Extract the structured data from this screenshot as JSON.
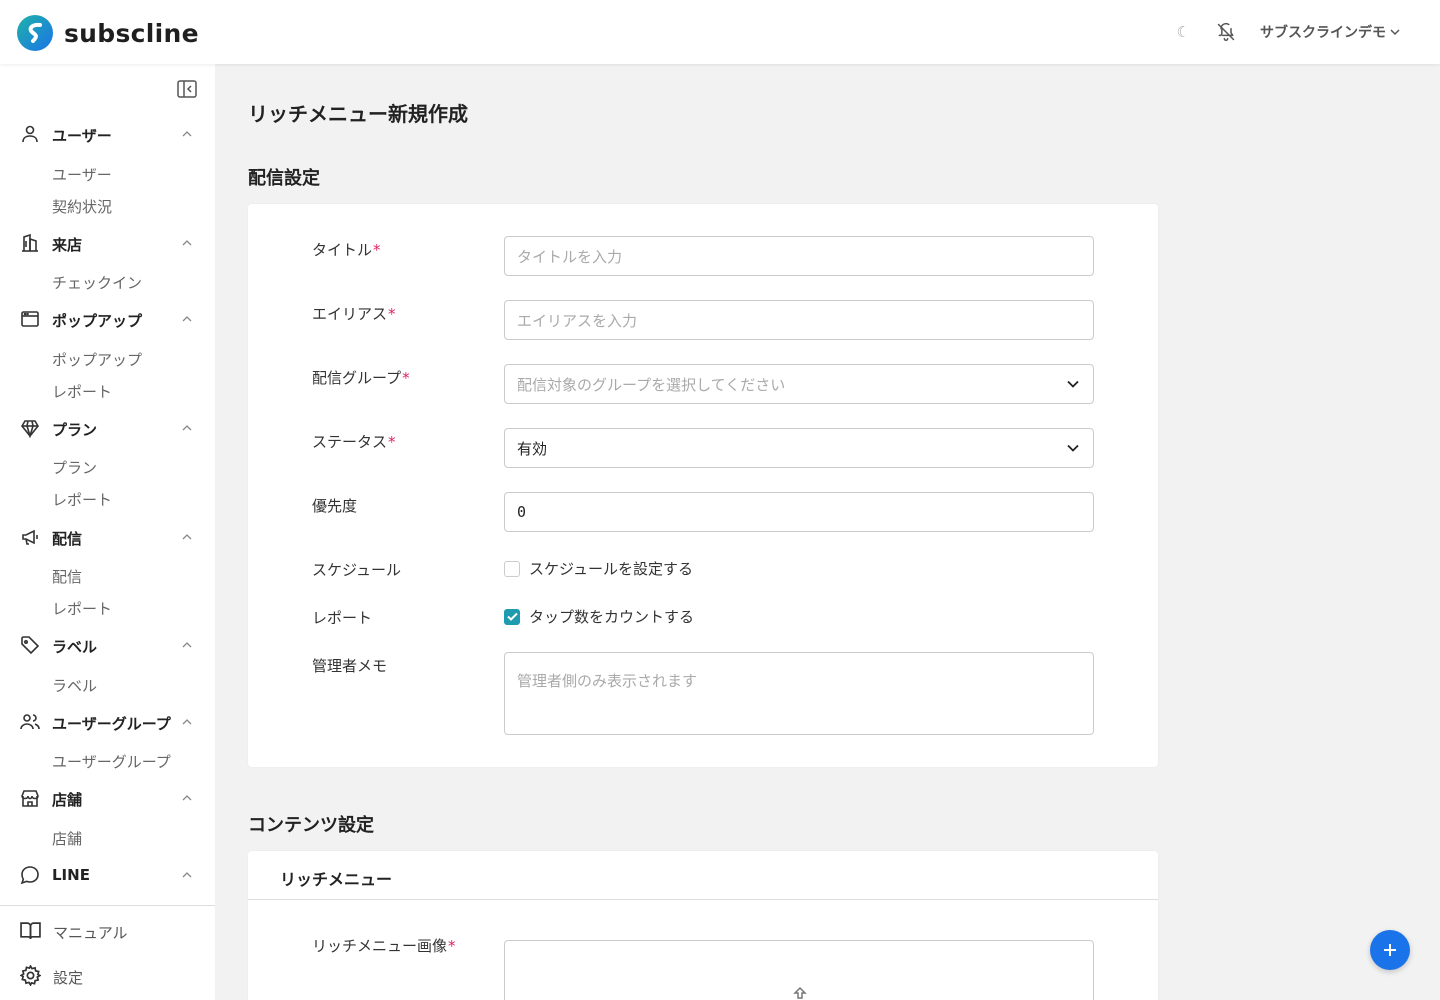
{
  "header": {
    "app_name": "subscline",
    "account_name": "サブスクラインデモ",
    "colors": {
      "logo_primary": "#1fb3a8",
      "logo_secondary": "#1a73e8"
    }
  },
  "sidebar": {
    "groups": [
      {
        "label": "ユーザー",
        "icon": "user-icon",
        "items": [
          "ユーザー",
          "契約状況"
        ]
      },
      {
        "label": "来店",
        "icon": "building-icon",
        "items": [
          "チェックイン"
        ]
      },
      {
        "label": "ポップアップ",
        "icon": "window-icon",
        "items": [
          "ポップアップ",
          "レポート"
        ]
      },
      {
        "label": "プラン",
        "icon": "diamond-icon",
        "items": [
          "プラン",
          "レポート"
        ]
      },
      {
        "label": "配信",
        "icon": "megaphone-icon",
        "items": [
          "配信",
          "レポート"
        ]
      },
      {
        "label": "ラベル",
        "icon": "tag-icon",
        "items": [
          "ラベル"
        ]
      },
      {
        "label": "ユーザーグループ",
        "icon": "users-icon",
        "items": [
          "ユーザーグループ"
        ]
      },
      {
        "label": "店舗",
        "icon": "store-icon",
        "items": [
          "店舗"
        ]
      },
      {
        "label": "LINE",
        "icon": "chat-bubble-icon",
        "items": []
      }
    ],
    "footer": [
      {
        "label": "マニュアル",
        "icon": "book-icon"
      },
      {
        "label": "設定",
        "icon": "gear-icon"
      }
    ]
  },
  "main": {
    "page_title": "リッチメニュー新規作成",
    "delivery_section": {
      "title": "配信設定",
      "title_field": {
        "label": "タイトル",
        "placeholder": "タイトルを入力"
      },
      "alias_field": {
        "label": "エイリアス",
        "placeholder": "エイリアスを入力"
      },
      "group_field": {
        "label": "配信グループ",
        "placeholder": "配信対象のグループを選択してください"
      },
      "status_field": {
        "label": "ステータス",
        "value": "有効"
      },
      "priority_field": {
        "label": "優先度",
        "value": "0"
      },
      "schedule_field": {
        "label": "スケジュール",
        "checkbox_label": "スケジュールを設定する",
        "checked": false
      },
      "report_field": {
        "label": "レポート",
        "checkbox_label": "タップ数をカウントする",
        "checked": true
      },
      "memo_field": {
        "label": "管理者メモ",
        "placeholder": "管理者側のみ表示されます"
      },
      "required_mark": "*"
    },
    "content_section": {
      "title": "コンテンツ設定",
      "card_title": "リッチメニュー",
      "image_field": {
        "label": "リッチメニュー画像"
      }
    }
  },
  "colors": {
    "accent": "#1f9bb0",
    "required": "#e0245e",
    "fab": "#1a73e8"
  }
}
